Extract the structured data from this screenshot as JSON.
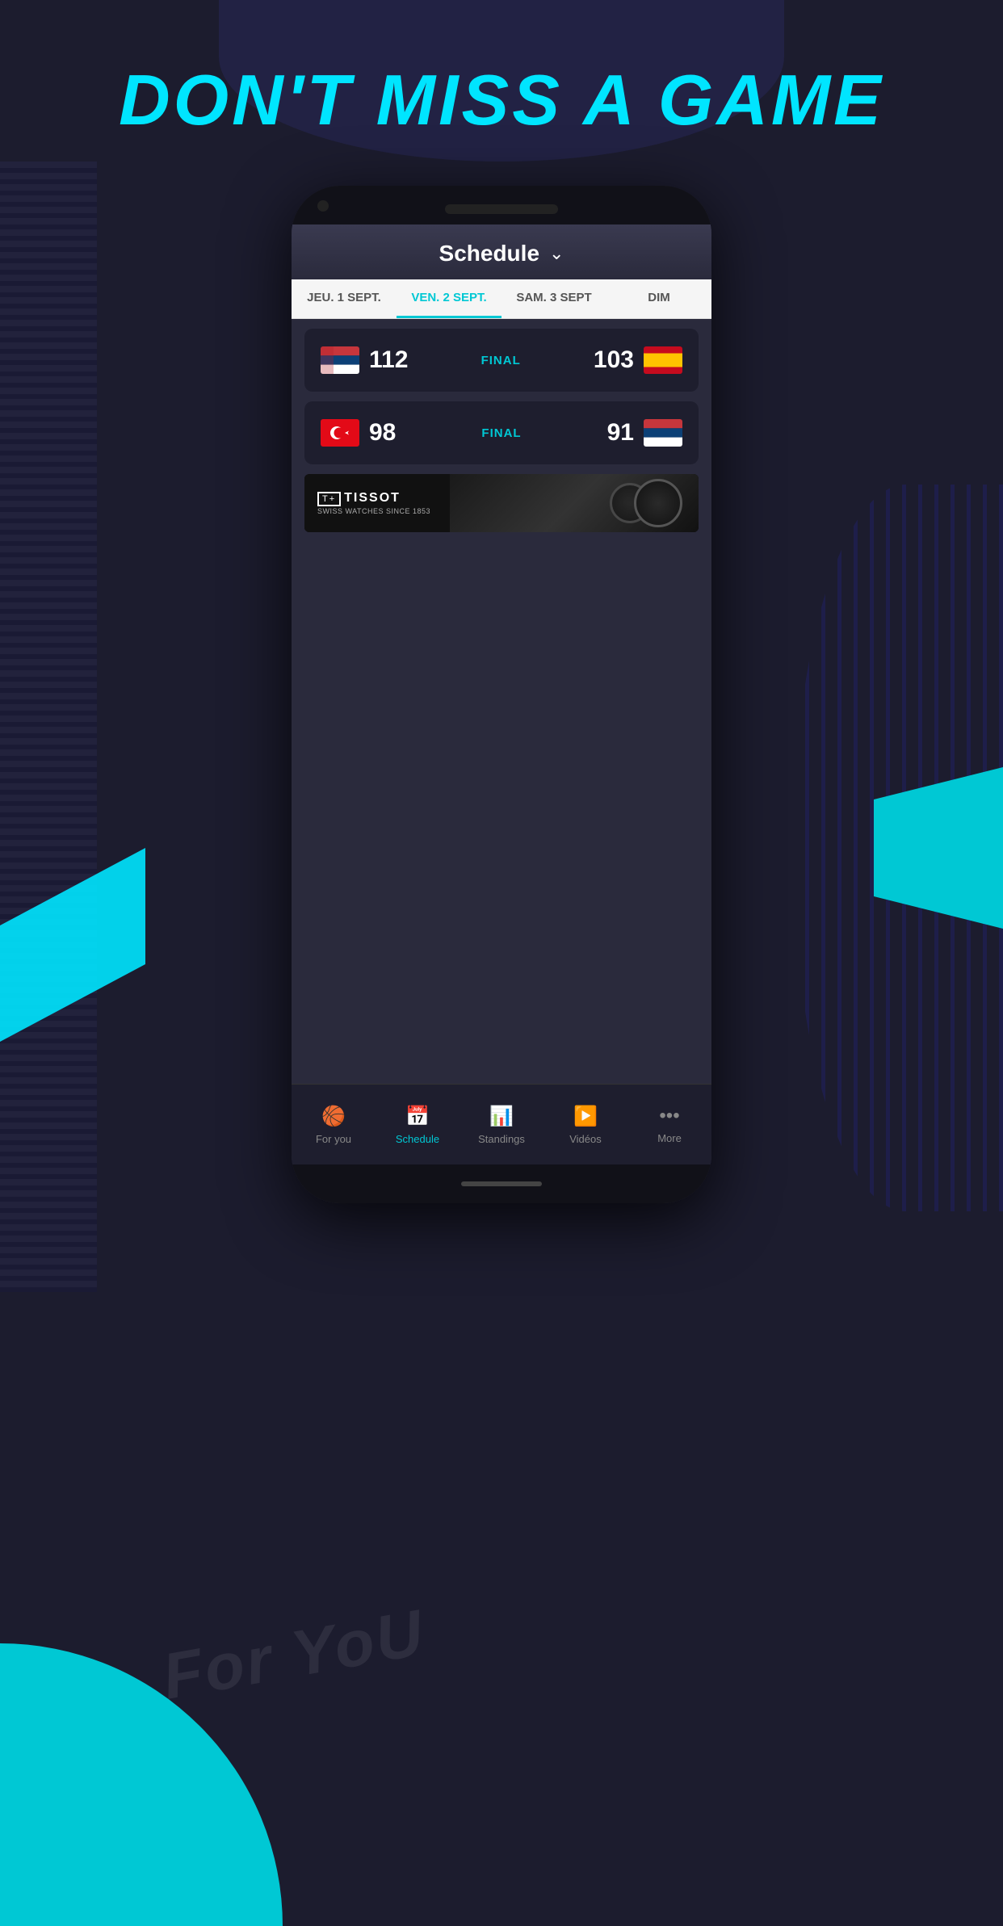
{
  "background": {
    "color": "#1c1c2e",
    "accent_cyan": "#00e5ff"
  },
  "headline": {
    "text": "DON'T MISS A GAME",
    "color": "#00e5ff"
  },
  "phone": {
    "schedule_header": {
      "title": "Schedule",
      "dropdown_icon": "chevron-down"
    },
    "date_tabs": [
      {
        "label": "JEU. 1 SEPT.",
        "active": false
      },
      {
        "label": "VEN. 2 SEPT.",
        "active": true
      },
      {
        "label": "SAM. 3 SEPT",
        "active": false
      },
      {
        "label": "DIM",
        "active": false
      }
    ],
    "matches": [
      {
        "team1_flag": "serbia",
        "team1_score": "112",
        "status": "FINAL",
        "team2_score": "103",
        "team2_flag": "spain"
      },
      {
        "team1_flag": "turkey",
        "team1_score": "98",
        "status": "FINAL",
        "team2_score": "91",
        "team2_flag": "serbia"
      }
    ],
    "ad": {
      "brand": "T+TISSOT",
      "tagline": "SWISS WATCHES SINCE 1853"
    },
    "bottom_nav": [
      {
        "label": "For you",
        "icon": "basketball",
        "active": false
      },
      {
        "label": "Schedule",
        "icon": "calendar",
        "active": true
      },
      {
        "label": "Standings",
        "icon": "bar-chart",
        "active": false
      },
      {
        "label": "Vidéos",
        "icon": "play-circle",
        "active": false
      },
      {
        "label": "More",
        "icon": "more",
        "active": false
      }
    ]
  },
  "for_you_watermark": "For YoU"
}
